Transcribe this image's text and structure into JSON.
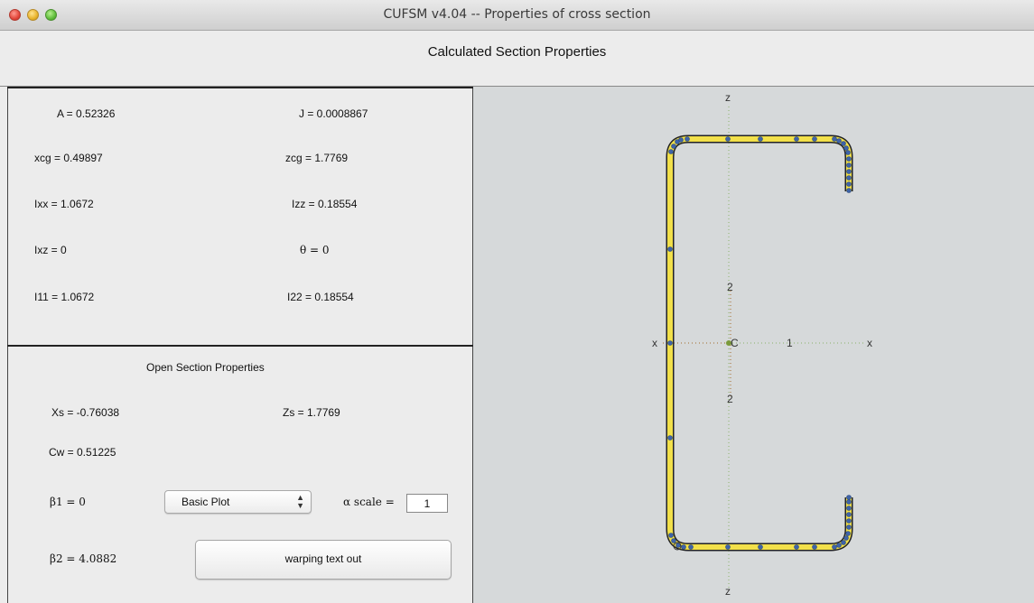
{
  "window": {
    "title": "CUFSM v4.04 -- Properties of cross section"
  },
  "header": {
    "title": "Calculated Section Properties"
  },
  "properties": {
    "A": "A = 0.52326",
    "J": "J = 0.0008867",
    "xcg": "xcg = 0.49897",
    "zcg": "zcg = 1.7769",
    "Ixx": "Ixx = 1.0672",
    "Izz": "Izz = 0.18554",
    "Ixz": "Ixz = 0",
    "theta": "θ = 0",
    "I11": "I11 = 1.0672",
    "I22": "I22 = 0.18554"
  },
  "open_section": {
    "title": "Open Section Properties",
    "Xs": "Xs = -0.76038",
    "Zs": "Zs = 1.7769",
    "Cw": "Cw = 0.51225",
    "beta1": "β1 = 0",
    "beta2": "β2 = 4.0882",
    "plot_select": "Basic Plot",
    "scale_label": "α  scale  =",
    "scale_value": "1",
    "warp_button": "warping text out"
  },
  "plot": {
    "axis_z_label": "z",
    "axis_x_label": "x",
    "centroid_label": "C",
    "axis1_label": "1",
    "axis2_label": "2",
    "section_fill": "#f2e04a",
    "node_color": "#3e63a8",
    "axis_color": "#a36c2a"
  }
}
